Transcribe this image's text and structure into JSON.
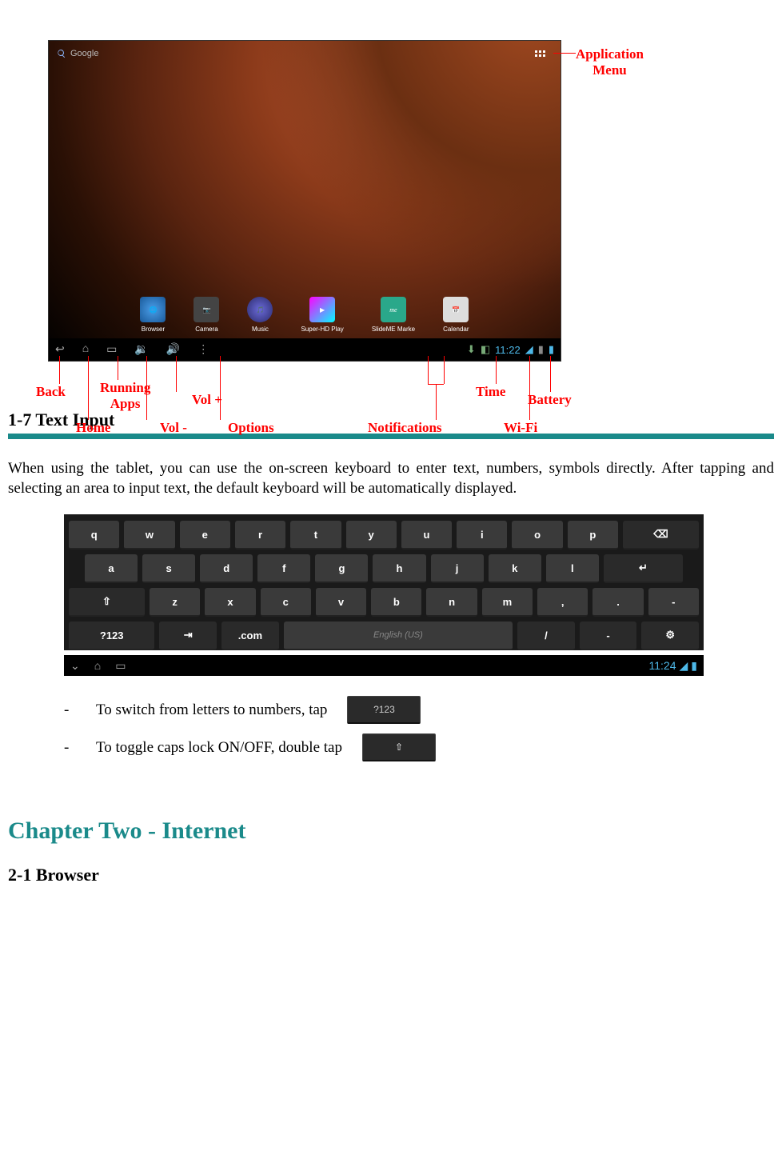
{
  "screenshot": {
    "search_placeholder": "Google",
    "dock": [
      {
        "label": "Browser",
        "color": "#2a6bb5"
      },
      {
        "label": "Camera",
        "color": "#555"
      },
      {
        "label": "Music",
        "color": "#333"
      },
      {
        "label": "Super-HD Play",
        "color": "#444"
      },
      {
        "label": "SlideME Marke",
        "color": "#2aa"
      },
      {
        "label": "Calendar",
        "color": "#cc9"
      }
    ],
    "time": "11:22",
    "annotations": {
      "app_menu": "Application\nMenu",
      "back": "Back",
      "home": "Home",
      "running_apps": "Running\nApps",
      "vol_minus": "Vol -",
      "vol_plus": "Vol +",
      "options": "Options",
      "notifications": "Notifications",
      "time": "Time",
      "wifi": "Wi-Fi",
      "battery": "Battery"
    }
  },
  "section1": {
    "heading": "1-7 Text Input",
    "body": "When using the tablet, you can use the on-screen keyboard to enter text, numbers, symbols directly. After tapping and selecting an area to input text, the default keyboard will be automatically displayed."
  },
  "keyboard": {
    "row1": [
      "q",
      "w",
      "e",
      "r",
      "t",
      "y",
      "u",
      "i",
      "o",
      "p",
      "⌫"
    ],
    "row2": [
      "a",
      "s",
      "d",
      "f",
      "g",
      "h",
      "j",
      "k",
      "l",
      "↵"
    ],
    "row3": [
      "⇧",
      "z",
      "x",
      "c",
      "v",
      "b",
      "n",
      "m",
      ",",
      ".",
      "-"
    ],
    "row4_sym": "?123",
    "row4_tab": "⇥",
    "row4_com": ".com",
    "row4_space": "English (US)",
    "row4_slash": "/",
    "row4_dash": "-",
    "row4_emoji": "⚙",
    "time": "11:24"
  },
  "bullets": {
    "b1": "To switch from letters to numbers, tap",
    "b1_key": "?123",
    "b2": "To toggle caps lock ON/OFF, double tap",
    "b2_key": "⇧"
  },
  "chapter2": {
    "title": "Chapter Two - Internet",
    "sub": "2-1 Browser"
  }
}
